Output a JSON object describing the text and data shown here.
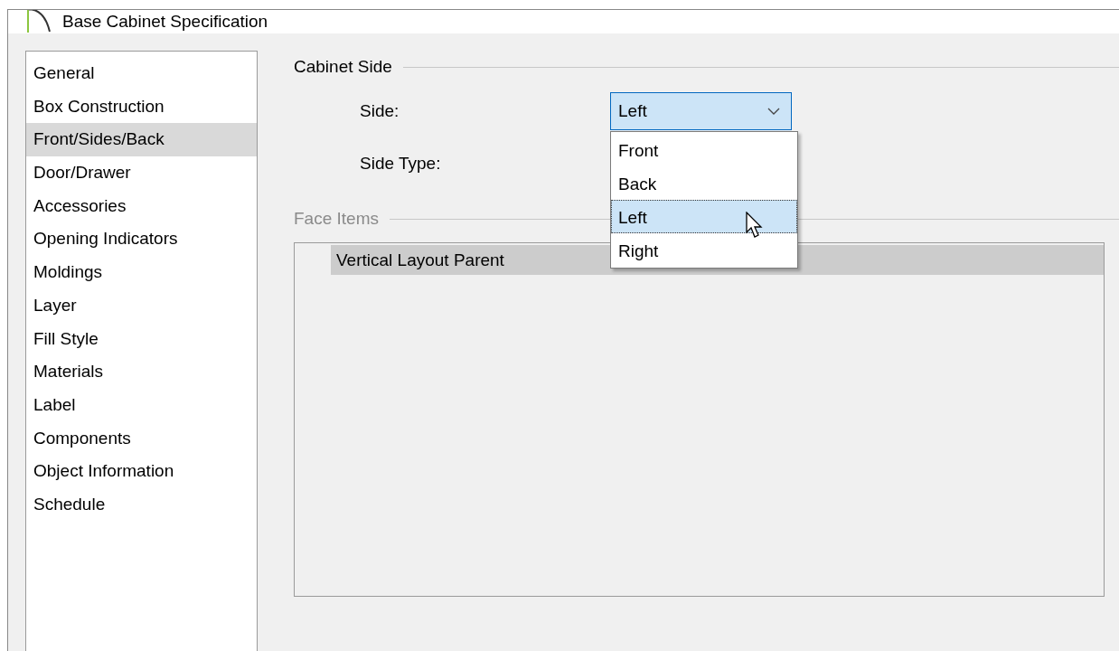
{
  "window": {
    "title": "Base Cabinet Specification"
  },
  "sidebar": {
    "items": [
      {
        "label": "General",
        "selected": false
      },
      {
        "label": "Box Construction",
        "selected": false
      },
      {
        "label": "Front/Sides/Back",
        "selected": true
      },
      {
        "label": "Door/Drawer",
        "selected": false
      },
      {
        "label": "Accessories",
        "selected": false
      },
      {
        "label": "Opening Indicators",
        "selected": false
      },
      {
        "label": "Moldings",
        "selected": false
      },
      {
        "label": "Layer",
        "selected": false
      },
      {
        "label": "Fill Style",
        "selected": false
      },
      {
        "label": "Materials",
        "selected": false
      },
      {
        "label": "Label",
        "selected": false
      },
      {
        "label": "Components",
        "selected": false
      },
      {
        "label": "Object Information",
        "selected": false
      },
      {
        "label": "Schedule",
        "selected": false
      }
    ]
  },
  "cabinet_side": {
    "title": "Cabinet Side",
    "side_label": "Side:",
    "side_value": "Left",
    "expanded": true,
    "options": [
      {
        "label": "Front",
        "selected": false
      },
      {
        "label": "Back",
        "selected": false
      },
      {
        "label": "Left",
        "selected": true
      },
      {
        "label": "Right",
        "selected": false
      }
    ],
    "side_type_label": "Side Type:"
  },
  "face_items": {
    "title": "Face Items",
    "disabled": true,
    "rows": [
      {
        "label": "Vertical Layout Parent",
        "selected": true
      }
    ]
  }
}
